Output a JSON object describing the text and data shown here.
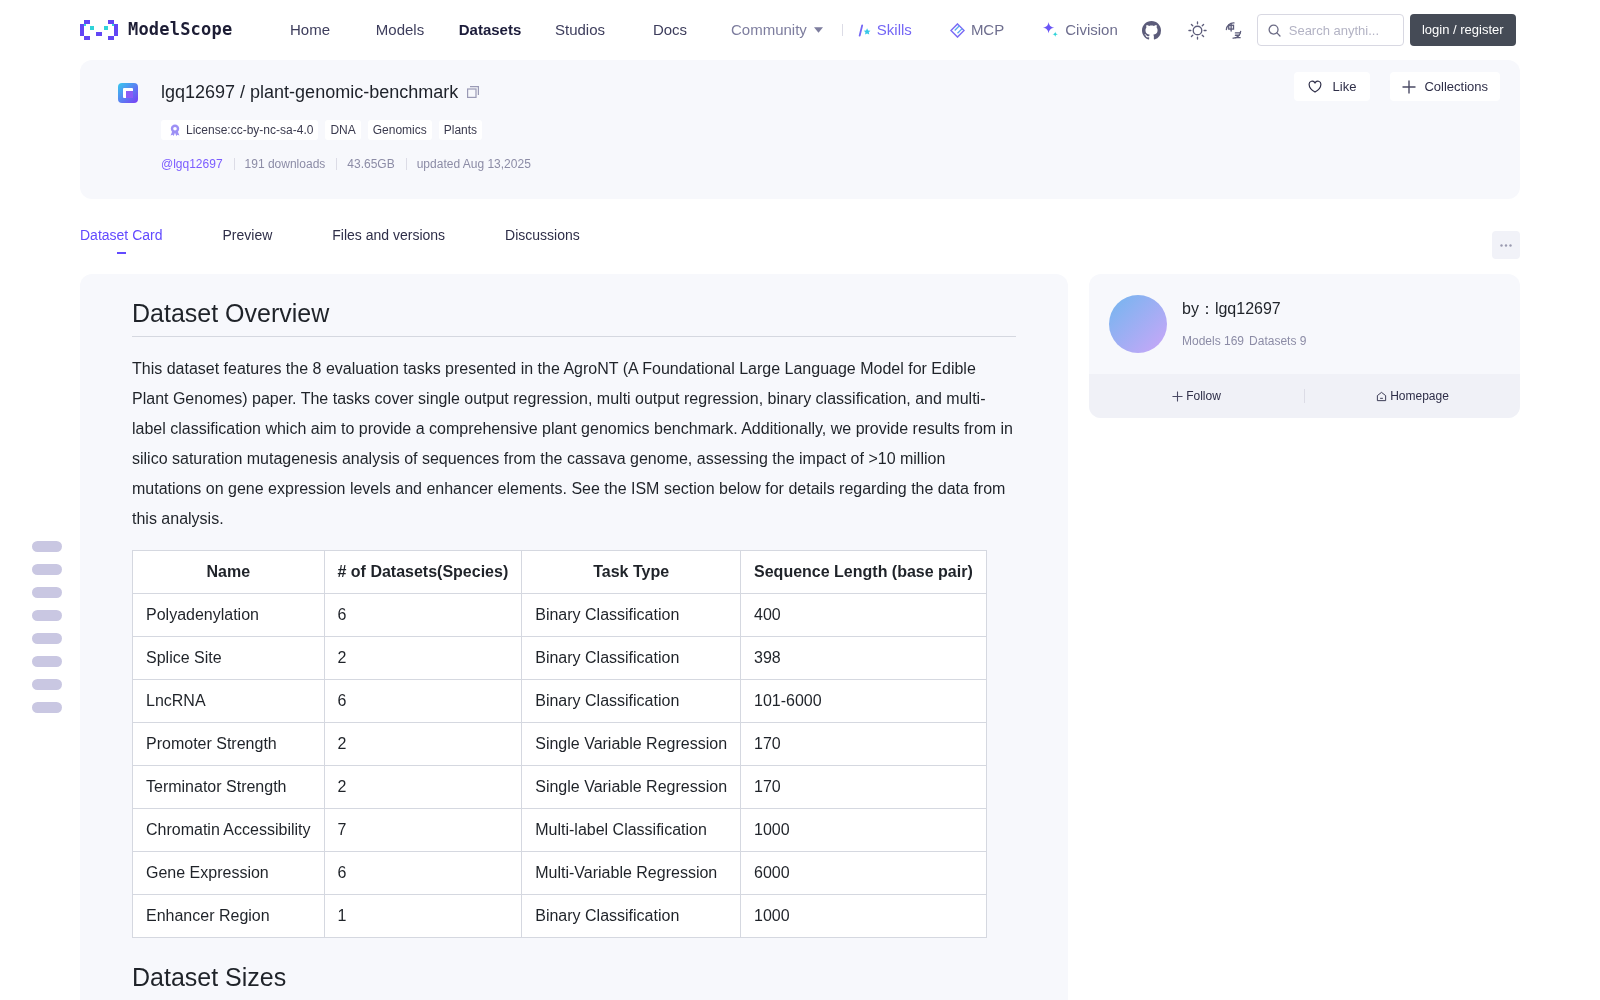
{
  "nav": {
    "logo": "ModelScope",
    "items": [
      {
        "label": "Home",
        "kind": "link",
        "selected": false
      },
      {
        "label": "Models",
        "kind": "link",
        "selected": false
      },
      {
        "label": "Datasets",
        "kind": "link",
        "selected": true
      },
      {
        "label": "Studios",
        "kind": "link",
        "selected": false
      },
      {
        "label": "Docs",
        "kind": "link",
        "selected": false
      },
      {
        "label": "Community",
        "kind": "dropdown",
        "selected": false
      }
    ],
    "features": [
      {
        "label": "Skills",
        "kind": "skills"
      },
      {
        "label": "MCP",
        "kind": "mcp"
      },
      {
        "label": "Civision",
        "kind": "civision"
      }
    ],
    "search": {
      "placeholder": "Search anythi..."
    },
    "login": "login / register"
  },
  "dataset": {
    "title": "lgq12697 / plant-genomic-benchmark",
    "tags": [
      {
        "label": "License:cc-by-nc-sa-4.0",
        "kind": "license"
      },
      {
        "label": "DNA",
        "kind": "tag"
      },
      {
        "label": "Genomics",
        "kind": "tag"
      },
      {
        "label": "Plants",
        "kind": "tag"
      }
    ],
    "meta": [
      {
        "text": "@lgq12697",
        "kind": "author"
      },
      {
        "text": "191 downloads",
        "kind": "stat"
      },
      {
        "text": "43.65GB",
        "kind": "stat"
      },
      {
        "text": "updated Aug 13,2025",
        "kind": "stat"
      }
    ],
    "actions": [
      {
        "label": "Like",
        "kind": "like"
      },
      {
        "label": "Collections",
        "kind": "collect"
      }
    ]
  },
  "tabs": [
    {
      "label": "Dataset Card",
      "selected": true
    },
    {
      "label": "Preview",
      "selected": false
    },
    {
      "label": "Files and versions",
      "selected": false
    },
    {
      "label": "Discussions",
      "selected": false
    }
  ],
  "card": {
    "sections": [
      {
        "kind": "heading",
        "text": "Dataset Overview"
      },
      {
        "kind": "paragraph",
        "text": "This dataset features the 8 evaluation tasks presented in the AgroNT (A Foundational Large Language Model for Edible Plant Genomes) paper. The tasks cover single output regression, multi output regression, binary classification, and multi-label classification which aim to provide a comprehensive plant genomics benchmark. Additionally, we provide results from in silico saturation mutagenesis analysis of sequences from the cassava genome, assessing the impact of >10 million mutations on gene expression levels and enhancer elements. See the ISM section below for details regarding the data from this analysis."
      },
      {
        "kind": "table",
        "columns": [
          "Name",
          "# of Datasets(Species)",
          "Task Type",
          "Sequence Length (base pair)"
        ],
        "rows": [
          [
            "Polyadenylation",
            "6",
            "Binary Classification",
            "400"
          ],
          [
            "Splice Site",
            "2",
            "Binary Classification",
            "398"
          ],
          [
            "LncRNA",
            "6",
            "Binary Classification",
            "101-6000"
          ],
          [
            "Promoter Strength",
            "2",
            "Single Variable Regression",
            "170"
          ],
          [
            "Terminator Strength",
            "2",
            "Single Variable Regression",
            "170"
          ],
          [
            "Chromatin Accessibility",
            "7",
            "Multi-label Classification",
            "1000"
          ],
          [
            "Gene Expression",
            "6",
            "Multi-Variable Regression",
            "6000"
          ],
          [
            "Enhancer Region",
            "1",
            "Binary Classification",
            "1000"
          ]
        ]
      },
      {
        "kind": "heading",
        "text": "Dataset Sizes"
      }
    ]
  },
  "author_card": {
    "title": "by：lgq12697",
    "stats": [
      "Models 169",
      "Datasets 9"
    ],
    "actions": [
      {
        "label": "Follow",
        "kind": "follow"
      },
      {
        "label": "Homepage",
        "kind": "homepage"
      }
    ]
  }
}
